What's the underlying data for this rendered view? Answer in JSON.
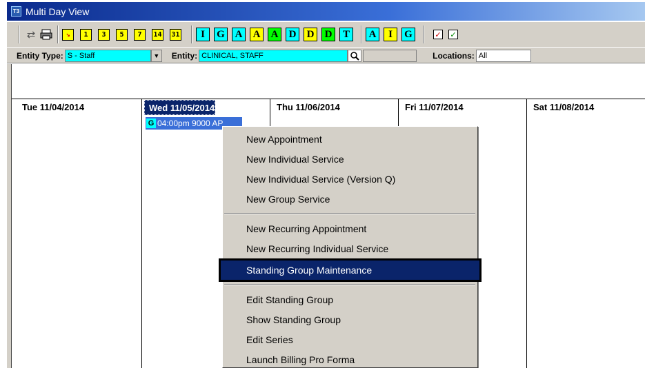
{
  "window": {
    "title": "Multi Day View",
    "icon": "T3"
  },
  "toolbar": {
    "day_buttons": [
      "1",
      "3",
      "5",
      "7",
      "14",
      "31"
    ],
    "type_buttons": [
      {
        "label": "I",
        "color": "#00ffff"
      },
      {
        "label": "G",
        "color": "#00ffff"
      },
      {
        "label": "A",
        "color": "#00ffff"
      },
      {
        "label": "A",
        "color": "#ffff00"
      },
      {
        "label": "A",
        "color": "#00ff00"
      },
      {
        "label": "D",
        "color": "#00ffff"
      },
      {
        "label": "D",
        "color": "#ffff00"
      },
      {
        "label": "D",
        "color": "#00ff00"
      },
      {
        "label": "T",
        "color": "#00ffff"
      }
    ],
    "type_buttons_2": [
      {
        "label": "A",
        "color": "#00ffff"
      },
      {
        "label": "I",
        "color": "#ffff00"
      },
      {
        "label": "G",
        "color": "#00ffff"
      }
    ]
  },
  "filters": {
    "entity_type_label": "Entity Type:",
    "entity_type_value": "S - Staff",
    "entity_label": "Entity:",
    "entity_value": "CLINICAL, STAFF",
    "locations_label": "Locations:",
    "locations_value": "All"
  },
  "days": [
    {
      "label": "Tue 11/04/2014",
      "selected": false
    },
    {
      "label": "Wed 11/05/2014",
      "selected": true
    },
    {
      "label": "Thu 11/06/2014",
      "selected": false
    },
    {
      "label": "Fri 11/07/2014",
      "selected": false
    },
    {
      "label": "Sat 11/08/2014",
      "selected": false
    }
  ],
  "appointment": {
    "badge": "G",
    "text": "04:00pm 9000 AP"
  },
  "context_menu": {
    "items": [
      "New Appointment",
      "New Individual Service",
      "New Individual Service (Version Q)",
      "New Group Service",
      "New Recurring Appointment",
      "New Recurring Individual Service",
      "Standing Group Maintenance",
      "Edit Standing Group",
      "Show Standing Group",
      "Edit Series",
      "Launch Billing Pro Forma"
    ],
    "highlighted": "Standing Group Maintenance"
  }
}
